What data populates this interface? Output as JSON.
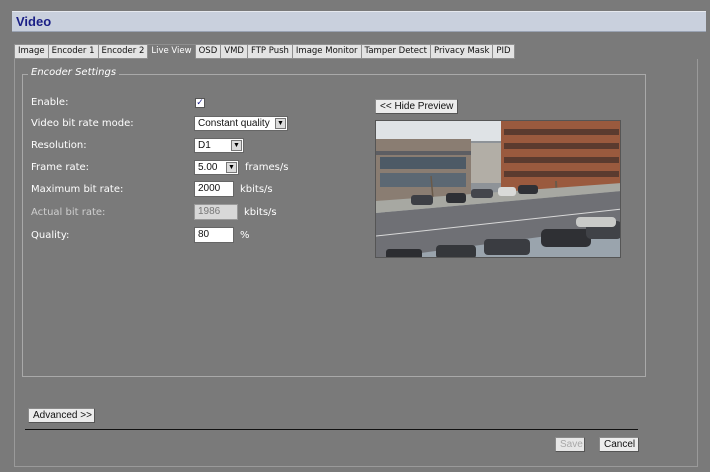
{
  "window": {
    "title": "Video"
  },
  "tabs": [
    {
      "label": "Image",
      "active": false
    },
    {
      "label": "Encoder 1",
      "active": false
    },
    {
      "label": "Encoder 2",
      "active": false
    },
    {
      "label": "Live View",
      "active": true
    },
    {
      "label": "OSD",
      "active": false
    },
    {
      "label": "VMD",
      "active": false
    },
    {
      "label": "FTP Push",
      "active": false
    },
    {
      "label": "Image Monitor",
      "active": false
    },
    {
      "label": "Tamper Detect",
      "active": false
    },
    {
      "label": "Privacy Mask",
      "active": false
    },
    {
      "label": "PID",
      "active": false
    }
  ],
  "encoder": {
    "legend": "Encoder Settings",
    "enable": {
      "label": "Enable:",
      "checked": true,
      "mark": "✓"
    },
    "bitrate_mode": {
      "label": "Video bit rate mode:",
      "value": "Constant quality"
    },
    "resolution": {
      "label": "Resolution:",
      "value": "D1"
    },
    "frame_rate": {
      "label": "Frame rate:",
      "value": "5.00",
      "unit": "frames/s"
    },
    "max_bitrate": {
      "label": "Maximum bit rate:",
      "value": "2000",
      "unit": "kbits/s"
    },
    "actual_bitrate": {
      "label": "Actual bit rate:",
      "value": "1986",
      "unit": "kbits/s"
    },
    "quality": {
      "label": "Quality:",
      "value": "80",
      "unit": "%"
    }
  },
  "preview": {
    "hide_button": "<< Hide Preview"
  },
  "footer": {
    "advanced_button": "Advanced >>",
    "save_button": "Save",
    "cancel_button": "Cancel"
  },
  "colors": {
    "background": "#7a7a7a",
    "titlebar": "#c9d0dd",
    "title_text": "#1a1f86"
  }
}
